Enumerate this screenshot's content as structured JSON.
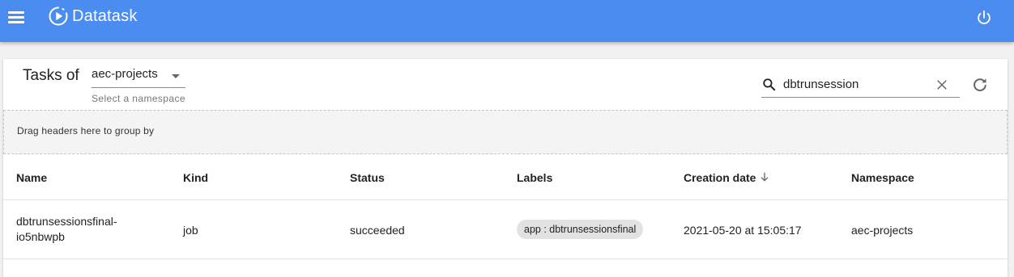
{
  "appbar": {
    "title": "Datatask",
    "colors": {
      "background": "#4a8cf0",
      "text": "#ffffff"
    },
    "icons": {
      "menu": "hamburger-menu-icon",
      "logo": "play-circle-logo-icon",
      "power": "power-icon"
    }
  },
  "toolbar": {
    "heading": "Tasks of",
    "namespace_select": {
      "value": "aec-projects",
      "helper": "Select a namespace"
    },
    "search": {
      "value": "dbtrunsession",
      "placeholder": ""
    },
    "icons": {
      "search": "search-icon",
      "clear": "close-icon",
      "refresh": "refresh-icon"
    }
  },
  "grid": {
    "group_panel_text": "Drag headers here to group by",
    "columns": [
      {
        "key": "name",
        "label": "Name"
      },
      {
        "key": "kind",
        "label": "Kind"
      },
      {
        "key": "status",
        "label": "Status"
      },
      {
        "key": "labels",
        "label": "Labels"
      },
      {
        "key": "creation_date",
        "label": "Creation date",
        "sort": "descending"
      },
      {
        "key": "namespace",
        "label": "Namespace"
      }
    ],
    "rows": [
      {
        "name_line1": "dbtrunsessionsfinal-",
        "name_line2": "io5nbwpb",
        "kind": "job",
        "status": "succeeded",
        "label": "app : dbtrunsessionsfinal",
        "creation_date": "2021-05-20 at 15:05:17",
        "namespace": "aec-projects"
      }
    ]
  }
}
